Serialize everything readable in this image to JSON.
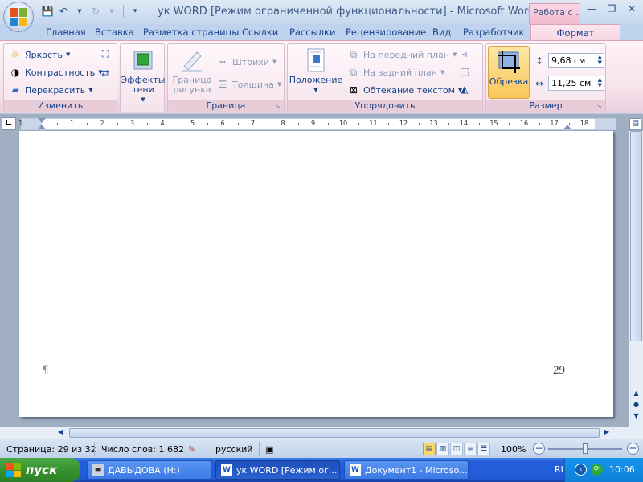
{
  "window": {
    "title": "ук WORD [Режим ограниченной функциональности] - Microsoft Word",
    "context_tab_title": "Работа с ..."
  },
  "tabs": [
    "Главная",
    "Вставка",
    "Разметка страницы",
    "Ссылки",
    "Рассылки",
    "Рецензирование",
    "Вид",
    "Разработчик"
  ],
  "active_tab": "Формат",
  "ribbon": {
    "adjust": {
      "label": "Изменить",
      "brightness": "Яркость",
      "contrast": "Контрастность",
      "recolor": "Перекрасить"
    },
    "shadow": {
      "label": "Эффекты тени"
    },
    "border": {
      "label": "Граница",
      "picture_border": "Граница рисунка",
      "dashes": "Штрихи",
      "weight": "Толщина"
    },
    "arrange": {
      "label": "Упорядочить",
      "position": "Положение",
      "bring_front": "На передний план",
      "send_back": "На задний план",
      "text_wrap": "Обтекание текстом"
    },
    "size": {
      "label": "Размер",
      "crop": "Обрезка",
      "height": "9,68 см",
      "width": "11,25 см"
    }
  },
  "ruler": {
    "numbers": [
      "1",
      "1",
      "2",
      "3",
      "4",
      "5",
      "6",
      "7",
      "8",
      "9",
      "10",
      "11",
      "12",
      "13",
      "14",
      "15",
      "16",
      "17",
      "18"
    ]
  },
  "document": {
    "paragraph_mark": "¶",
    "page_number": "29"
  },
  "status": {
    "page": "Страница: 29 из 32",
    "words": "Число слов: 1 682",
    "language": "русский",
    "zoom": "100%",
    "zoom_level_percent": 100
  },
  "taskbar": {
    "start": "пуск",
    "items": [
      {
        "label": "ДАВЫДОВА (H:)",
        "active": false
      },
      {
        "label": "ук WORD [Режим ог...",
        "active": true
      },
      {
        "label": "Документ1 - Microso...",
        "active": false
      }
    ],
    "lang": "RU",
    "clock": "10:06"
  },
  "colors": {
    "ribbon_context": "#f6e1ea",
    "taskbar": "#245edb",
    "start": "#36932e"
  }
}
